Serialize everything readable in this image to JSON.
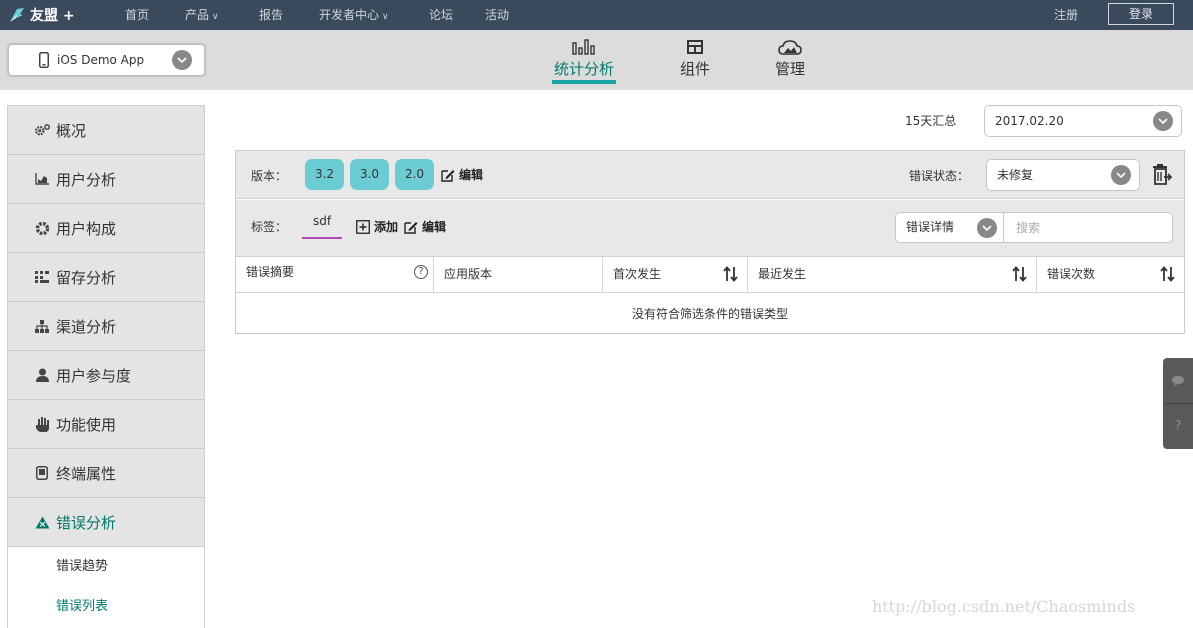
{
  "topnav": {
    "brand": "友盟 +",
    "items": [
      "首页",
      "产品",
      "报告",
      "开发者中心",
      "论坛",
      "活动"
    ],
    "register": "注册",
    "login": "登录"
  },
  "app_selector": {
    "value": "iOS Demo App"
  },
  "main_tabs": [
    {
      "label": "统计分析",
      "icon": "bar-chart-icon"
    },
    {
      "label": "组件",
      "icon": "component-icon"
    },
    {
      "label": "管理",
      "icon": "cloud-icon"
    }
  ],
  "sidebar": {
    "items": [
      {
        "label": "概况",
        "icon": "gears-icon"
      },
      {
        "label": "用户分析",
        "icon": "area-chart-icon"
      },
      {
        "label": "用户构成",
        "icon": "gear-icon"
      },
      {
        "label": "留存分析",
        "icon": "grid-icon"
      },
      {
        "label": "渠道分析",
        "icon": "sitemap-icon"
      },
      {
        "label": "用户参与度",
        "icon": "user-icon"
      },
      {
        "label": "功能使用",
        "icon": "hand-icon"
      },
      {
        "label": "终端属性",
        "icon": "tablet-icon"
      },
      {
        "label": "错误分析",
        "icon": "warning-icon"
      }
    ],
    "sub_items": [
      "错误趋势",
      "错误列表"
    ]
  },
  "summary": {
    "label": "15天汇总",
    "date": "2017.02.20"
  },
  "filters": {
    "version_label": "版本：",
    "versions": [
      "3.2",
      "3.0",
      "2.0"
    ],
    "edit": "编辑",
    "error_status_label": "错误状态：",
    "error_status_value": "未修复",
    "tag_label": "标签：",
    "tag": "sdf",
    "add": "添加",
    "detail_select": "错误详情",
    "search_placeholder": "搜索"
  },
  "table": {
    "columns": [
      "错误摘要",
      "应用版本",
      "首次发生",
      "最近发生",
      "错误次数"
    ],
    "empty_text": "没有符合筛选条件的错误类型"
  },
  "float_buttons": [
    "comment-icon",
    "help-icon"
  ],
  "watermark": "http://blog.csdn.net/Chaosminds",
  "colors": {
    "accent": "#00796b",
    "pill": "#6cccd4",
    "nav_bg": "#3a4a5c",
    "tab_underline": "#1aa3a3"
  }
}
